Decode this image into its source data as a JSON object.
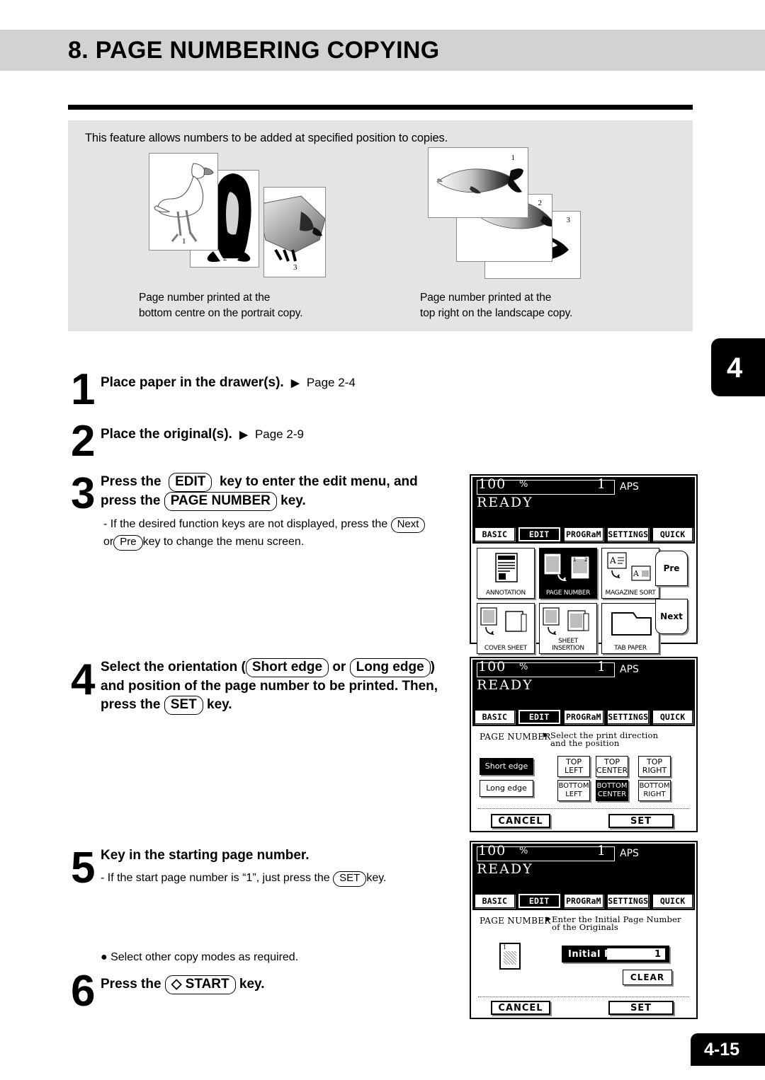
{
  "header": {
    "title": "8. PAGE NUMBERING COPYING"
  },
  "intro": {
    "description": "This feature allows numbers to be added at specified position to copies.",
    "caption_left_line1": "Page number printed at the",
    "caption_left_line2": "bottom centre on the portrait copy.",
    "caption_right_line1": "Page number printed at the",
    "caption_right_line2": "top right on the landscape copy.",
    "portrait_page_numbers": [
      "1",
      "2",
      "3"
    ],
    "landscape_page_numbers": [
      "1",
      "2",
      "3"
    ]
  },
  "side_tab": {
    "chapter": "4"
  },
  "page_tab": {
    "number": "4-15"
  },
  "steps": [
    {
      "number": "1",
      "title": "Place paper in the drawer(s).",
      "arrow": "▶",
      "reference": "Page 2-4"
    },
    {
      "number": "2",
      "title": "Place the original(s).",
      "arrow": "▶",
      "reference": "Page 2-9"
    },
    {
      "number": "3",
      "title_part1": "Press the",
      "key1": "EDIT",
      "title_part2": "key to enter the edit menu, and",
      "title_part3": "press the",
      "key2": "PAGE NUMBER",
      "title_part4": "key.",
      "note_part1": "-  If the desired function keys are not displayed, press the",
      "note_key1": "Next",
      "note_part2": "or",
      "note_key2": "Pre",
      "note_part3": "key to change the menu screen."
    },
    {
      "number": "4",
      "title_part1": "Select the orientation (",
      "key1": "Short edge",
      "title_part2": "or",
      "key2": "Long edge",
      "title_part3": ")",
      "title_part4": "and position of the page number to be printed. Then,",
      "title_part5": "press the",
      "key3": "SET",
      "title_part6": "key."
    },
    {
      "number": "5",
      "title": "Key in the starting page number.",
      "note_part1": "-  If the start page number is “1”, just press the",
      "note_key": "SET",
      "note_part2": "key."
    },
    {
      "number": "6",
      "bullet": "● Select other copy modes as required.",
      "title_part1": "Press the",
      "key1": "◇ START",
      "title_part2": "key."
    }
  ],
  "lcd_common": {
    "zoom": "100",
    "percent": "%",
    "copy_count": "1",
    "paper_mode": "APS",
    "status": "READY",
    "tabs": [
      "BASIC",
      "EDIT",
      "PROGRaM",
      "SETTINGS",
      "QUICK"
    ],
    "selected_tab": "EDIT"
  },
  "lcd_panel_edit_menu": {
    "function_keys": [
      {
        "label": "ANNOTATION",
        "selected": false
      },
      {
        "label": "PAGE NUMBER",
        "selected": true
      },
      {
        "label": "MAGAZINE SORT",
        "selected": false
      },
      {
        "label": "COVER SHEET",
        "selected": false
      },
      {
        "label": "SHEET\nINSERTION",
        "selected": false
      },
      {
        "label": "TAB PAPER",
        "selected": false
      }
    ],
    "nav_prev": "Pre",
    "nav_next": "Next"
  },
  "lcd_panel_position": {
    "mode_label": "PAGE NUMBER",
    "prompt_arrow": "▶",
    "prompt_line1": "Select the print direction",
    "prompt_line2": "and the position",
    "orientation": [
      {
        "label": "Short edge",
        "selected": true
      },
      {
        "label": "Long edge",
        "selected": false
      }
    ],
    "positions": [
      {
        "label": "TOP\nLEFT",
        "selected": false
      },
      {
        "label": "TOP\nCENTER",
        "selected": false
      },
      {
        "label": "TOP\nRIGHT",
        "selected": false
      },
      {
        "label": "BOTTOM\nLEFT",
        "selected": false
      },
      {
        "label": "BOTTOM\nCENTER",
        "selected": true
      },
      {
        "label": "BOTTOM\nRIGHT",
        "selected": false
      }
    ],
    "cancel": "CANCEL",
    "set": "SET"
  },
  "lcd_panel_initial_page": {
    "mode_label": "PAGE NUMBER",
    "prompt_arrow": "▶",
    "prompt_line1": "Enter the Initial Page Number",
    "prompt_line2": "of the Originals",
    "field_label": "Initial Page :",
    "field_value": "1",
    "sheet_number": "1",
    "clear": "CLEAR",
    "cancel": "CANCEL",
    "set": "SET"
  },
  "colors": {
    "title_band": "#d2d2d2",
    "intro_box": "#e4e4e4",
    "accent_black": "#000000"
  }
}
